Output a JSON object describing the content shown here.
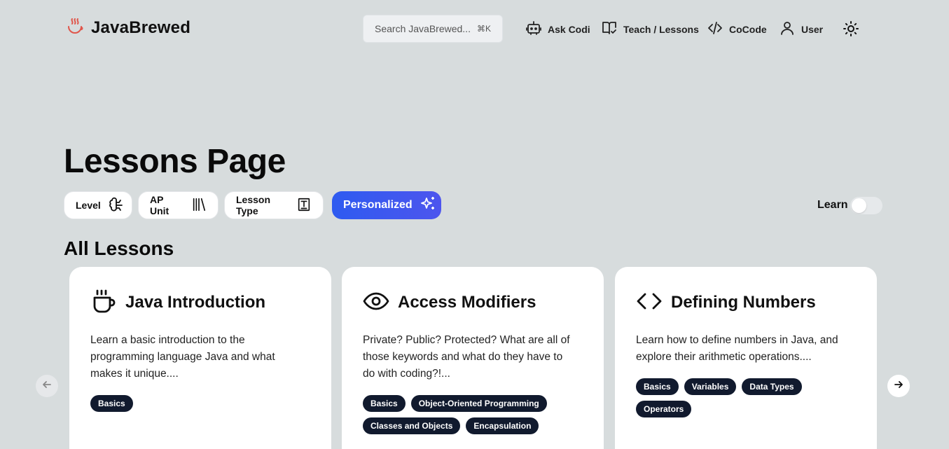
{
  "app": {
    "name": "JavaBrewed"
  },
  "search": {
    "placeholder": "Search JavaBrewed...",
    "shortcut": "⌘K"
  },
  "nav": [
    {
      "label": "Ask Codi",
      "icon": "robot-icon"
    },
    {
      "label": "Teach / Lessons",
      "icon": "book-check-icon"
    },
    {
      "label": "CoCode",
      "icon": "code-icon"
    },
    {
      "label": "User",
      "icon": "user-icon"
    }
  ],
  "theme_toggle": {
    "icon": "sun-icon"
  },
  "page": {
    "title": "Lessons Page"
  },
  "filters": [
    {
      "label": "Level",
      "icon": "brain-icon"
    },
    {
      "label": "AP Unit",
      "icon": "library-icon"
    },
    {
      "label": "Lesson Type",
      "icon": "text-box-icon"
    },
    {
      "label": "Personalized",
      "icon": "sparkles-icon",
      "active": true
    }
  ],
  "learn_toggle": {
    "label": "Learn",
    "on": false
  },
  "section": {
    "title": "All Lessons"
  },
  "lessons": [
    {
      "title": "Java Introduction",
      "icon": "coffee-icon",
      "description": "Learn a basic introduction to the programming language Java and what makes it unique....",
      "tags": [
        "Basics"
      ]
    },
    {
      "title": "Access Modifiers",
      "icon": "eye-icon",
      "description": "Private? Public? Protected? What are all of those keywords and what do they have to do with coding?!...",
      "tags": [
        "Basics",
        "Object-Oriented Programming",
        "Classes and Objects",
        "Encapsulation"
      ]
    },
    {
      "title": "Defining Numbers",
      "icon": "code-brackets-icon",
      "description": "Learn how to define numbers in Java, and explore their arithmetic operations....",
      "tags": [
        "Basics",
        "Variables",
        "Data Types",
        "Operators"
      ]
    }
  ],
  "colors": {
    "background": "#d7dcdd",
    "accent": "#2e5bf0",
    "tag": "#111a2e",
    "logo": "#e0564b"
  }
}
